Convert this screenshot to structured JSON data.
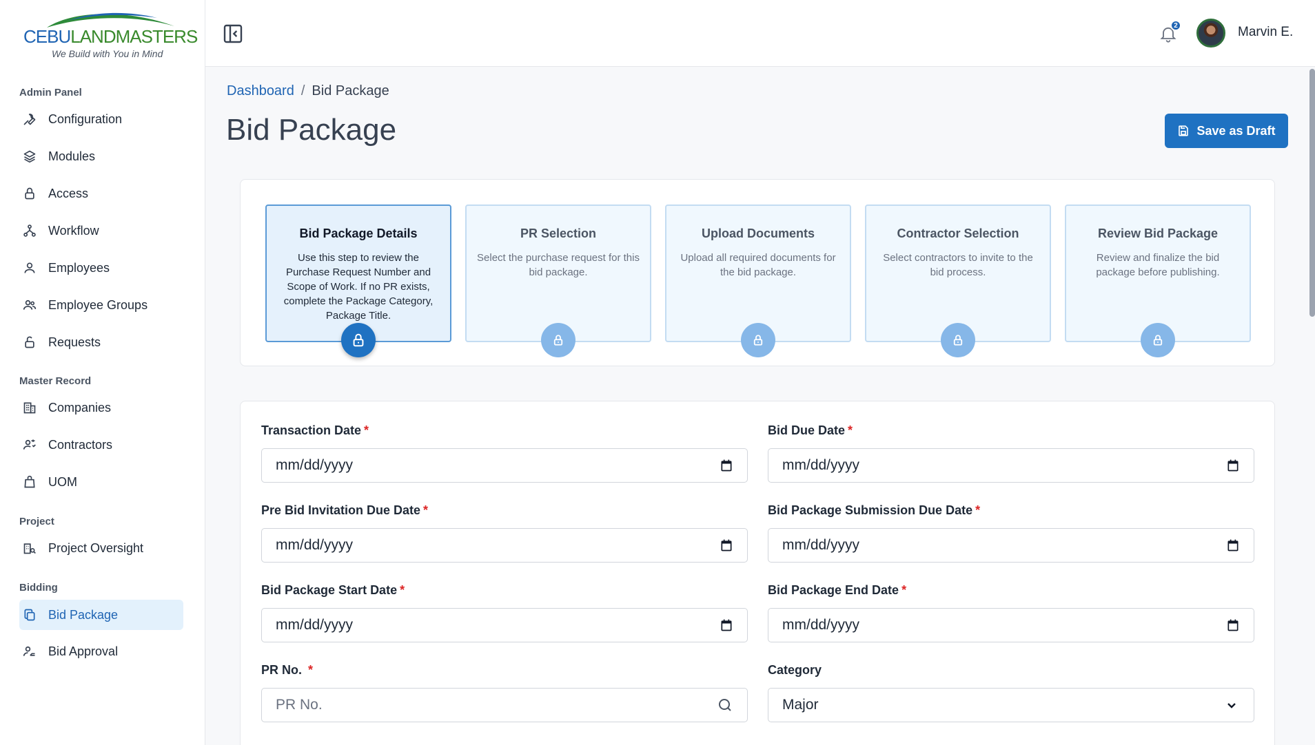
{
  "brand": {
    "name_part1": "CEBU",
    "name_part2": "LANDMASTERS",
    "tagline": "We Build with You in Mind"
  },
  "sidebar": {
    "sections": [
      {
        "title": "Admin Panel",
        "items": [
          {
            "label": "Configuration",
            "icon": "wrench-icon"
          },
          {
            "label": "Modules",
            "icon": "layers-icon"
          },
          {
            "label": "Access",
            "icon": "lock-icon"
          },
          {
            "label": "Workflow",
            "icon": "workflow-icon"
          },
          {
            "label": "Employees",
            "icon": "user-icon"
          },
          {
            "label": "Employee Groups",
            "icon": "users-icon"
          },
          {
            "label": "Requests",
            "icon": "unlock-icon"
          }
        ]
      },
      {
        "title": "Master Record",
        "items": [
          {
            "label": "Companies",
            "icon": "building-icon"
          },
          {
            "label": "Contractors",
            "icon": "contractor-icon"
          },
          {
            "label": "UOM",
            "icon": "weight-icon"
          }
        ]
      },
      {
        "title": "Project",
        "items": [
          {
            "label": "Project Oversight",
            "icon": "project-icon"
          }
        ]
      },
      {
        "title": "Bidding",
        "items": [
          {
            "label": "Bid Package",
            "icon": "copy-icon",
            "active": true
          },
          {
            "label": "Bid Approval",
            "icon": "approval-icon"
          }
        ]
      }
    ]
  },
  "header": {
    "notification_count": "2",
    "user_name": "Marvin E."
  },
  "breadcrumb": {
    "root": "Dashboard",
    "separator": "/",
    "current": "Bid Package"
  },
  "page": {
    "title": "Bid Package",
    "save_label": "Save as Draft"
  },
  "steps": [
    {
      "title": "Bid Package Details",
      "desc": "Use this step to review the Purchase Request Number and Scope of Work. If no PR exists, complete the Package Category, Package Title.",
      "active": true
    },
    {
      "title": "PR Selection",
      "desc": "Select the purchase request for this bid package."
    },
    {
      "title": "Upload Documents",
      "desc": "Upload all required documents for the bid package."
    },
    {
      "title": "Contractor Selection",
      "desc": "Select contractors to invite to the bid process."
    },
    {
      "title": "Review Bid Package",
      "desc": "Review and finalize the bid package before publishing."
    }
  ],
  "form": {
    "required_mark": "*",
    "transaction_date": {
      "label": "Transaction Date",
      "value": "mm/dd/yyyy"
    },
    "bid_due_date": {
      "label": "Bid Due Date",
      "value": "mm/dd/yyyy"
    },
    "pre_bid_invitation_due_date": {
      "label": "Pre Bid Invitation Due Date",
      "value": "mm/dd/yyyy"
    },
    "bid_package_submission_due_date": {
      "label": "Bid Package Submission Due Date",
      "value": "mm/dd/yyyy"
    },
    "bid_package_start_date": {
      "label": "Bid Package Start Date",
      "value": "mm/dd/yyyy"
    },
    "bid_package_end_date": {
      "label": "Bid Package End Date",
      "value": "mm/dd/yyyy"
    },
    "pr_no": {
      "label": "PR No.",
      "placeholder": "PR No."
    },
    "category": {
      "label": "Category",
      "value": "Major"
    }
  },
  "colors": {
    "primary": "#1f72c2",
    "active_nav_bg": "#e3f1fc",
    "required": "#dc2626"
  }
}
